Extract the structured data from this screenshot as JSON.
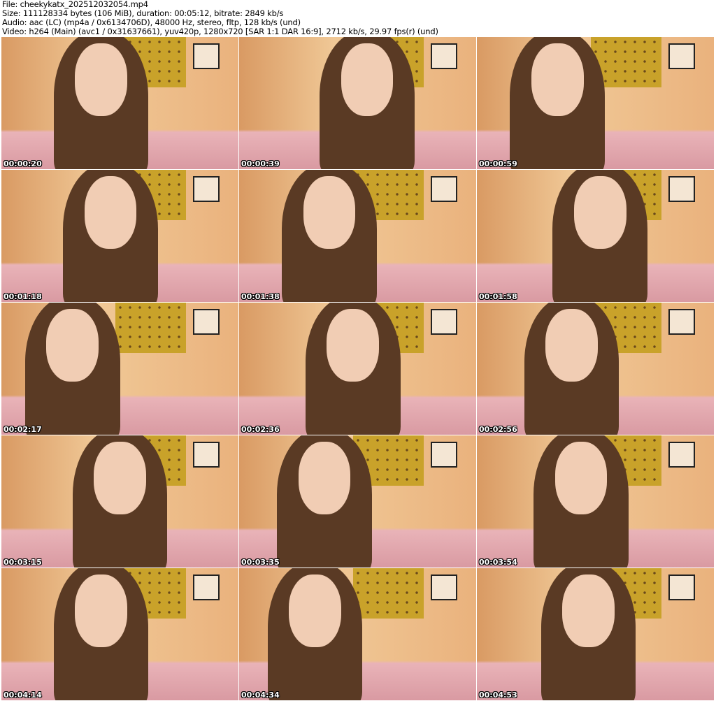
{
  "info": {
    "file": "File: cheekykatx_202512032054.mp4",
    "size": "Size: 111128334 bytes (106 MiB), duration: 00:05:12, bitrate: 2849 kb/s",
    "audio": "Audio: aac (LC) (mp4a / 0x6134706D), 48000 Hz, stereo, fltp, 128 kb/s (und)",
    "video": "Video: h264 (Main) (avc1 / 0x31637661), yuv420p, 1280x720 [SAR 1:1 DAR 16:9], 2712 kb/s, 29.97 fps(r) (und)"
  },
  "thumbnails": [
    {
      "time": "00:00:20"
    },
    {
      "time": "00:00:39"
    },
    {
      "time": "00:00:59"
    },
    {
      "time": "00:01:18"
    },
    {
      "time": "00:01:38"
    },
    {
      "time": "00:01:58"
    },
    {
      "time": "00:02:17"
    },
    {
      "time": "00:02:36"
    },
    {
      "time": "00:02:56"
    },
    {
      "time": "00:03:15"
    },
    {
      "time": "00:03:35"
    },
    {
      "time": "00:03:54"
    },
    {
      "time": "00:04:14"
    },
    {
      "time": "00:04:34"
    },
    {
      "time": "00:04:53"
    }
  ]
}
